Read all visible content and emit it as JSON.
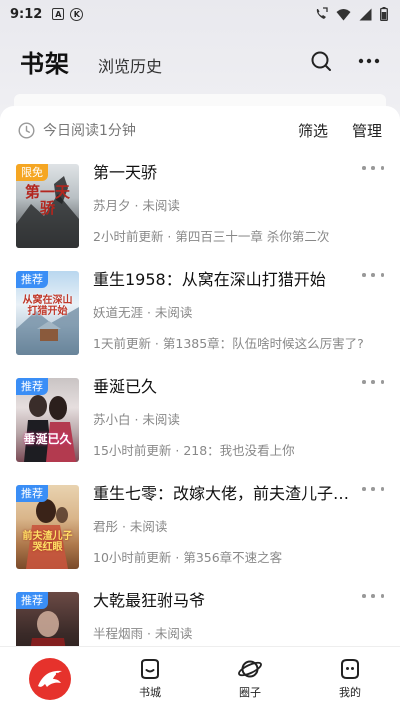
{
  "status_bar": {
    "time": "9:12",
    "icon_a": "A",
    "icon_k": "K"
  },
  "header": {
    "title": "书架",
    "history_tab": "浏览历史"
  },
  "reading": {
    "today_text": "今日阅读1分钟",
    "filter": "筛选",
    "manage": "管理"
  },
  "books": [
    {
      "title": "第一天骄",
      "author_status": "苏月夕 · 未阅读",
      "update": "2小时前更新 · 第四百三十一章 杀你第二次",
      "tag": "限免",
      "tag_color": "#f5a623",
      "cover_text": "第一天骄"
    },
    {
      "title": "重生1958：从窝在深山打猎开始",
      "author_status": "妖道无涯 · 未阅读",
      "update": "1天前更新 · 第1385章：队伍啥时候这么厉害了?",
      "tag": "推荐",
      "tag_color": "#3a8ef6",
      "cover_text": "从窝在深山打猎开始"
    },
    {
      "title": "垂涎已久",
      "author_status": "苏小白 · 未阅读",
      "update": "15小时前更新 · 218：我也没看上你",
      "tag": "推荐",
      "tag_color": "#3a8ef6",
      "cover_text": "垂涎已久"
    },
    {
      "title": "重生七零：改嫁大佬，前夫渣儿子哭红眼",
      "author_status": "君彤 · 未阅读",
      "update": "10小时前更新 · 第356章不速之客",
      "tag": "推荐",
      "tag_color": "#3a8ef6",
      "cover_text": "前夫渣儿子哭红眼"
    },
    {
      "title": "大乾最狂驸马爷",
      "author_status": "半程烟雨 · 未阅读",
      "update": "",
      "tag": "推荐",
      "tag_color": "#3a8ef6",
      "cover_text": ""
    }
  ],
  "nav": {
    "store": "书城",
    "circle": "圈子",
    "mine": "我的"
  },
  "colors": {
    "accent": "#e6322c"
  }
}
